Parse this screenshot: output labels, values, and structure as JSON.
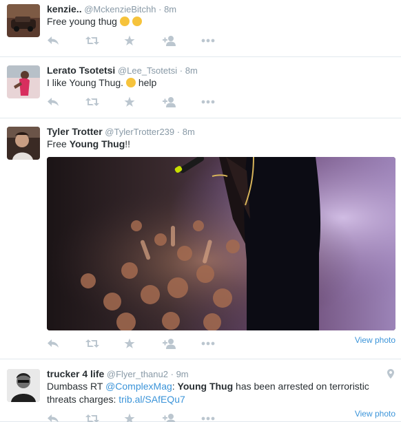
{
  "tweets": [
    {
      "fullname": "kenzie..",
      "username": "@MckenzieBitchh",
      "sep": "·",
      "time": "8m",
      "text": "Free young thug"
    },
    {
      "fullname": "Lerato Tsotetsi",
      "username": "@Lee_Tsotetsi",
      "sep": "·",
      "time": "8m",
      "text_before": "I like Young Thug.",
      "text_after": "help"
    },
    {
      "fullname": "Tyler Trotter",
      "username": "@TylerTrotter239",
      "sep": "·",
      "time": "8m",
      "text_prefix": "Free ",
      "text_bold": "Young Thug",
      "text_suffix": "!!",
      "view_photo": "View photo"
    },
    {
      "fullname": "trucker 4 life",
      "username": "@Flyer_thanu2",
      "sep": "·",
      "time": "9m",
      "text_1": "Dumbass RT ",
      "mention": "@ComplexMag",
      "text_2": ": ",
      "bold": "Young Thug",
      "text_3": " has been arrested on terroristic threats charges: ",
      "link": "trib.al/SAfEQu7",
      "view_photo": "View photo"
    }
  ],
  "icons": [
    "reply-icon",
    "retweet-icon",
    "favorite-icon",
    "follow-icon",
    "more-icon"
  ],
  "colors": {
    "action_icon": "#bbc6cf",
    "link": "#3b94d9",
    "secondary": "#8899a6"
  }
}
